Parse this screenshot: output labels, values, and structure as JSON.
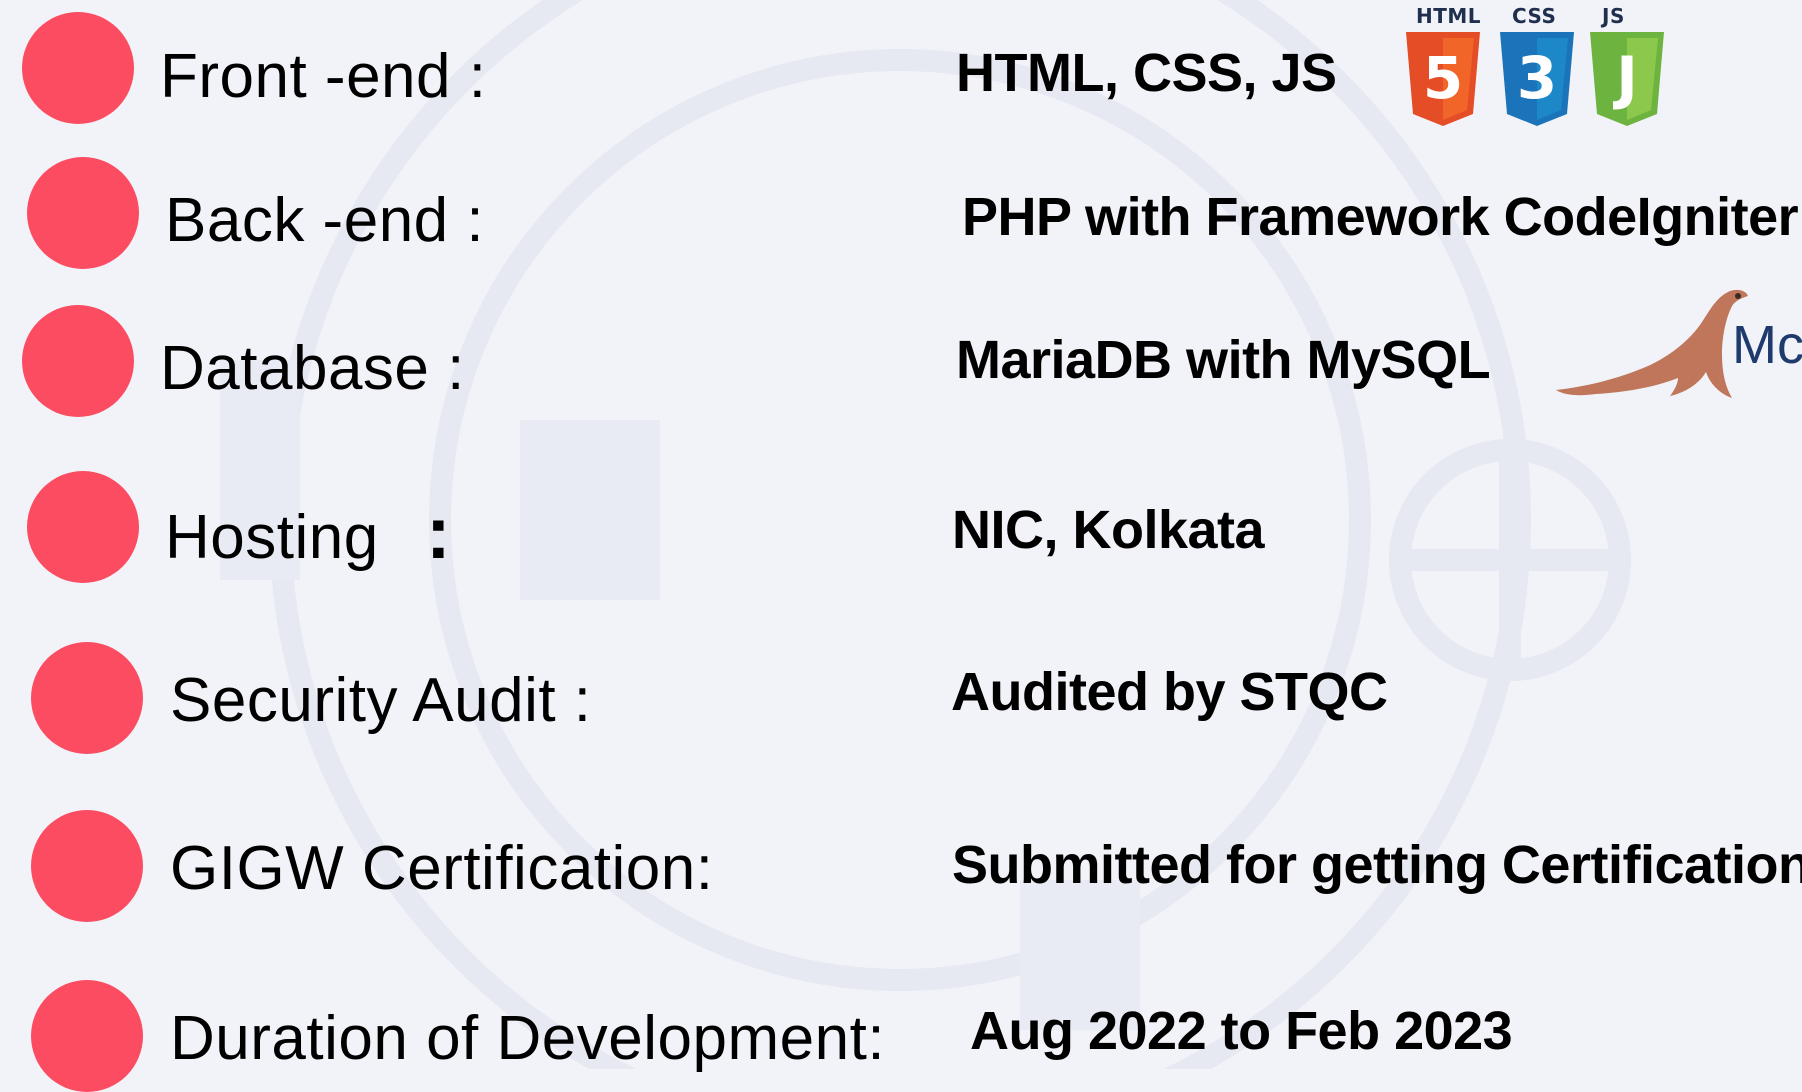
{
  "rows": [
    {
      "label": "Front -end :",
      "value": "HTML, CSS, JS"
    },
    {
      "label": "Back -end :",
      "value": "PHP with Framework CodeIgniter"
    },
    {
      "label": "Database :",
      "value": "MariaDB with MySQL"
    },
    {
      "label": "Hosting",
      "colon": ":",
      "value": "NIC, Kolkata"
    },
    {
      "label": "Security Audit :",
      "value": "Audited by STQC"
    },
    {
      "label": "GIGW Certification:",
      "value": "Submitted for getting Certification"
    },
    {
      "label": "Duration of Development:",
      "value": "Aug 2022 to Feb 2023"
    }
  ],
  "logos": {
    "html": {
      "label": "HTML",
      "glyph": "5",
      "icon": "html5-shield-icon",
      "color": "#e44d26"
    },
    "css": {
      "label": "CSS",
      "glyph": "3",
      "icon": "css3-shield-icon",
      "color": "#1b73ba"
    },
    "js": {
      "label": "JS",
      "glyph": "J",
      "icon": "js-shield-icon",
      "color": "#6db33f"
    },
    "mariadb": {
      "text": "Mc",
      "icon": "mariadb-seal-icon",
      "color": "#c0765a"
    }
  },
  "colors": {
    "bullet": "#fb4c62",
    "background": "#f2f3f8"
  }
}
